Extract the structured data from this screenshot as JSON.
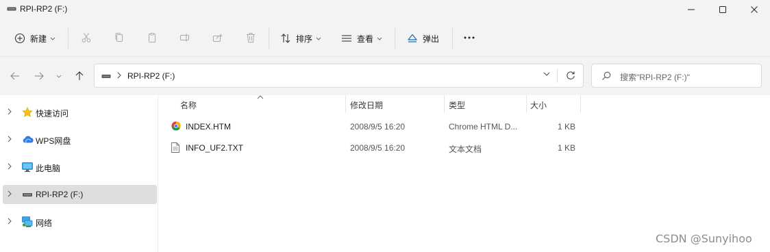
{
  "window": {
    "title": "RPI-RP2 (F:)"
  },
  "toolbar": {
    "new_label": "新建",
    "sort_label": "排序",
    "view_label": "查看",
    "eject_label": "弹出",
    "more_label": "···"
  },
  "address": {
    "path": "RPI-RP2 (F:)"
  },
  "search": {
    "placeholder": "搜索\"RPI-RP2 (F:)\""
  },
  "sidebar": {
    "items": [
      {
        "label": "快速访问",
        "icon": "star-icon"
      },
      {
        "label": "WPS网盘",
        "icon": "cloud-icon"
      },
      {
        "label": "此电脑",
        "icon": "monitor-icon"
      },
      {
        "label": "RPI-RP2 (F:)",
        "icon": "drive-icon",
        "selected": true
      },
      {
        "label": "网络",
        "icon": "network-icon"
      }
    ]
  },
  "file_list": {
    "columns": {
      "name": "名称",
      "modified": "修改日期",
      "type": "类型",
      "size": "大小"
    },
    "rows": [
      {
        "name": "INDEX.HTM",
        "modified": "2008/9/5 16:20",
        "type": "Chrome HTML D...",
        "size": "1 KB",
        "icon": "chrome-html-icon"
      },
      {
        "name": "INFO_UF2.TXT",
        "modified": "2008/9/5 16:20",
        "type": "文本文档",
        "size": "1 KB",
        "icon": "text-document-icon"
      }
    ]
  },
  "watermark": "CSDN @Sunyihoo"
}
